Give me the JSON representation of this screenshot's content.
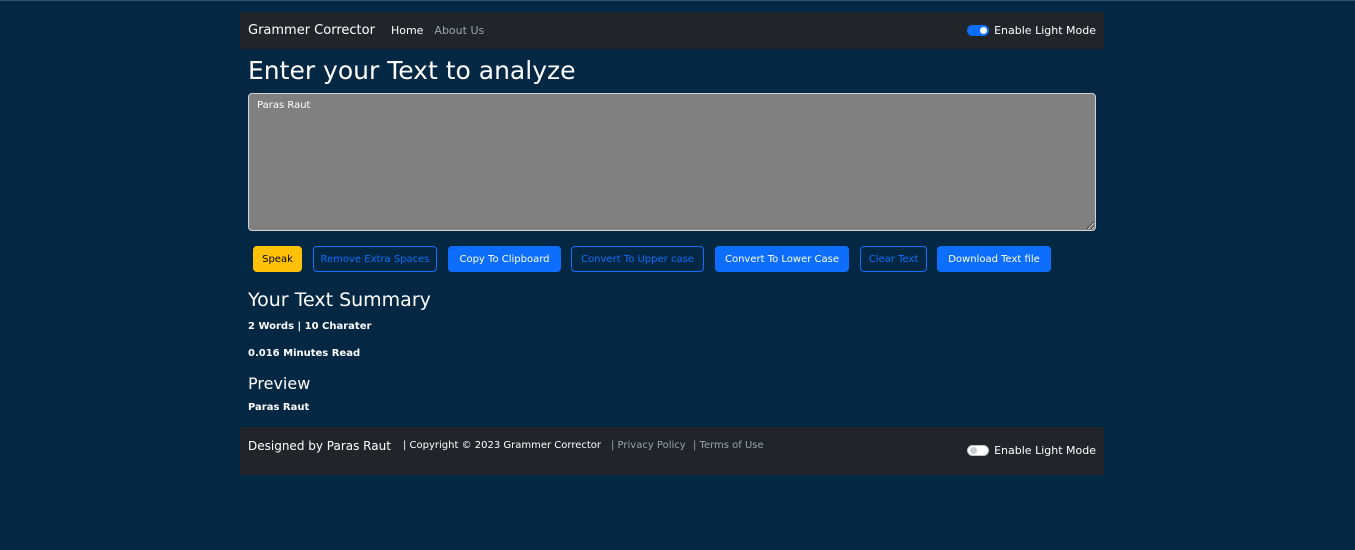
{
  "navbar": {
    "brand": "Grammer Corrector",
    "links": [
      {
        "label": "Home"
      },
      {
        "label": "About Us"
      }
    ],
    "mode_toggle_label": "Enable Light Mode"
  },
  "main": {
    "heading": "Enter your Text to analyze",
    "textarea_value": "Paras Raut",
    "buttons": [
      {
        "label": "Speak",
        "style": "warning"
      },
      {
        "label": "Remove Extra Spaces",
        "style": "outline-primary"
      },
      {
        "label": "Copy To Clipboard",
        "style": "primary"
      },
      {
        "label": "Convert To Upper case",
        "style": "outline-primary"
      },
      {
        "label": "Convert To Lower Case",
        "style": "primary"
      },
      {
        "label": "Clear Text",
        "style": "outline-primary"
      },
      {
        "label": "Download Text file",
        "style": "primary"
      }
    ]
  },
  "summary": {
    "heading": "Your Text Summary",
    "counts": "2 Words | 10 Charater",
    "read_time": "0.016 Minutes Read"
  },
  "preview": {
    "heading": "Preview",
    "text": "Paras Raut"
  },
  "footer": {
    "designed_by": "Designed by Paras Raut",
    "copyright": "| Copyright © 2023 Grammer Corrector",
    "privacy": "| Privacy Policy",
    "terms": "| Terms of Use",
    "mode_toggle_label": "Enable Light Mode"
  },
  "colors": {
    "page_background": "#042743",
    "bar_background": "#212529",
    "primary": "#0d6efd",
    "warning": "#ffc107",
    "textarea_background": "#808080"
  }
}
